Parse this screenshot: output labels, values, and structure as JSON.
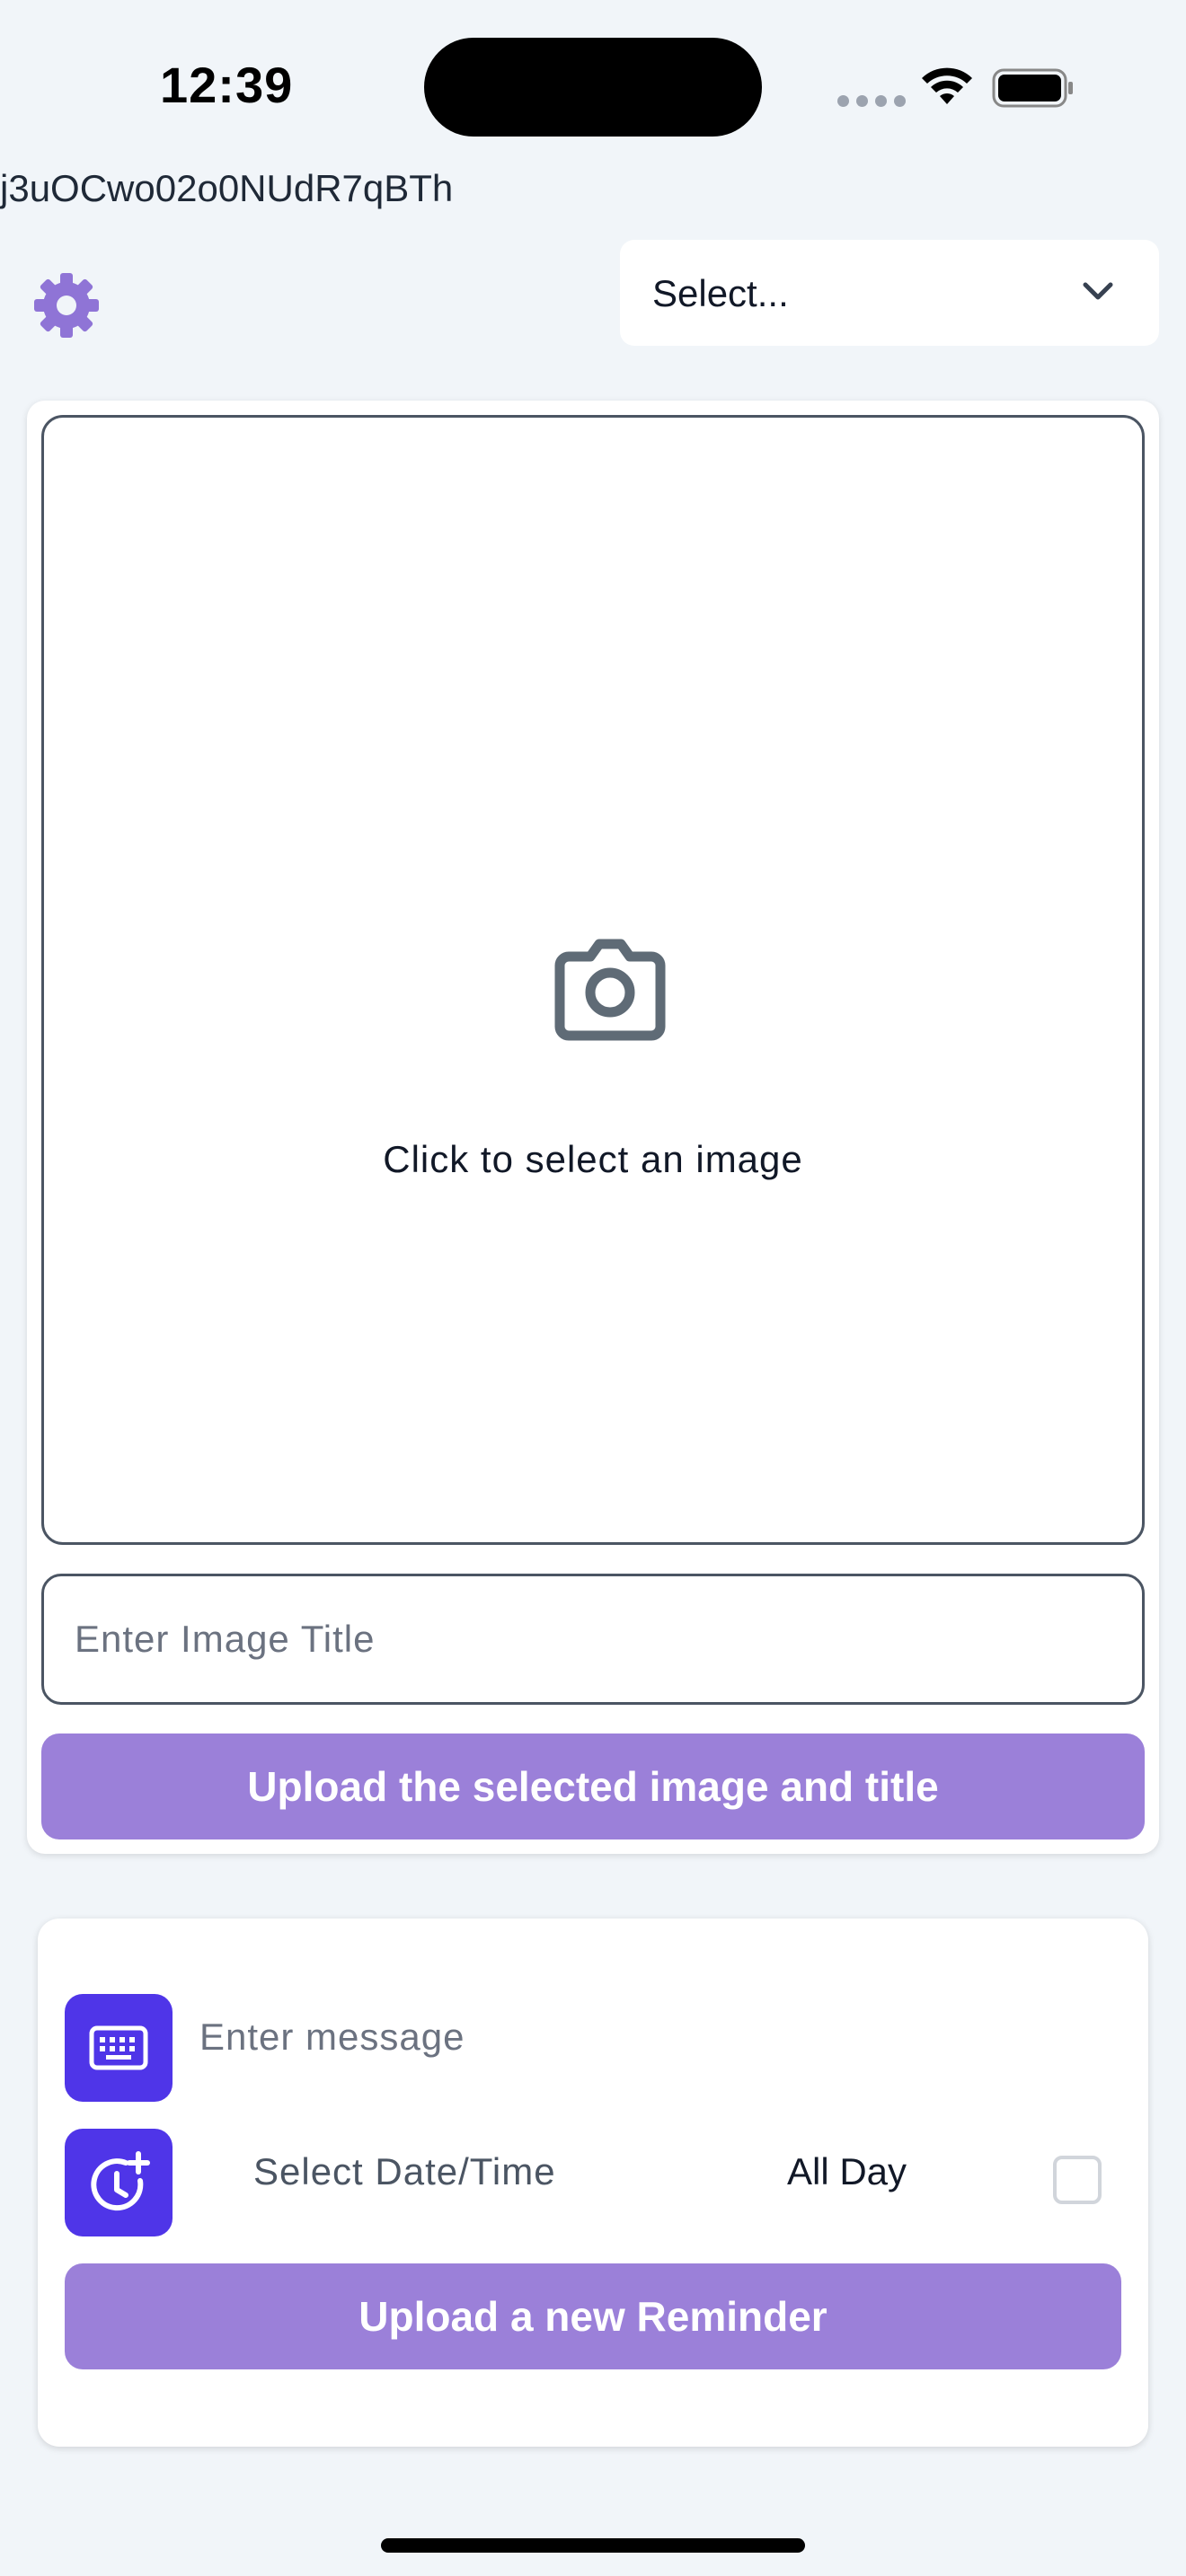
{
  "status_bar": {
    "time": "12:39"
  },
  "header": {
    "session_id": "j3uOCwo02o0NUdR7qBTh",
    "select_label": "Select..."
  },
  "image_upload": {
    "picker_label": "Click to select an image",
    "title_placeholder": "Enter Image Title",
    "title_value": "",
    "upload_button_label": "Upload the selected image and title"
  },
  "reminder": {
    "message_placeholder": "Enter message",
    "message_value": "",
    "date_time_label": "Select Date/Time",
    "all_day_label": "All Day",
    "all_day_checked": false,
    "upload_button_label": "Upload a new Reminder"
  },
  "colors": {
    "accent": "#9b80d9",
    "icon_tile": "#4f35e8",
    "background": "#f1f5f9"
  },
  "icons": [
    "gear-icon",
    "chevron-down-icon",
    "camera-icon",
    "keyboard-icon",
    "clock-plus-icon",
    "wifi-icon",
    "battery-icon"
  ]
}
